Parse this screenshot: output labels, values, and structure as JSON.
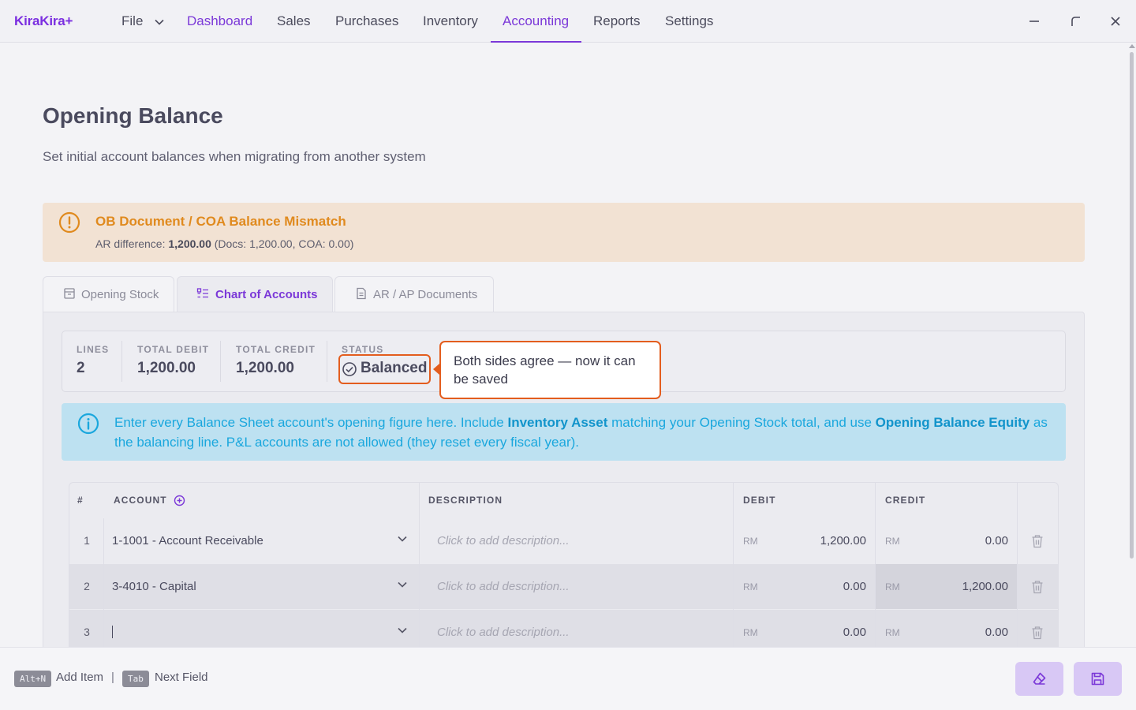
{
  "app": {
    "logo": "KiraKira+"
  },
  "nav": {
    "file": "File",
    "items": [
      "Dashboard",
      "Sales",
      "Purchases",
      "Inventory",
      "Accounting",
      "Reports",
      "Settings"
    ],
    "active": "Accounting"
  },
  "page": {
    "title": "Opening Balance",
    "subtitle": "Set initial account balances when migrating from another system"
  },
  "warning": {
    "title": "OB Document / COA Balance Mismatch",
    "prefix": "AR difference: ",
    "amount": "1,200.00",
    "detail": " (Docs: 1,200.00, COA: 0.00)"
  },
  "tabs": [
    {
      "label": "Opening Stock",
      "icon": "box-icon"
    },
    {
      "label": "Chart of Accounts",
      "icon": "list-icon",
      "active": true
    },
    {
      "label": "AR / AP Documents",
      "icon": "document-icon"
    }
  ],
  "stats": {
    "lines_label": "LINES",
    "lines": "2",
    "debit_label": "TOTAL DEBIT",
    "debit": "1,200.00",
    "credit_label": "TOTAL CREDIT",
    "credit": "1,200.00",
    "status_label": "STATUS",
    "status": "Balanced"
  },
  "tooltip": {
    "text": "Both sides agree — now it can be saved"
  },
  "info": {
    "part1": "Enter every Balance Sheet account's opening figure here. Include ",
    "bold1": "Inventory Asset",
    "part2": " matching your Opening Stock total, and use ",
    "bold2": "Opening Balance Equity",
    "part3": " as the balancing line. P&L accounts are not allowed (they reset every fiscal year)."
  },
  "table": {
    "headers": {
      "num": "#",
      "account": "ACCOUNT",
      "description": "DESCRIPTION",
      "debit": "DEBIT",
      "credit": "CREDIT"
    },
    "currency": "RM",
    "rows": [
      {
        "num": "1",
        "account": "1-1001 - Account Receivable",
        "description": "Click to add description...",
        "debit": "1,200.00",
        "credit": "0.00"
      },
      {
        "num": "2",
        "account": "3-4010 - Capital",
        "description": "Click to add description...",
        "debit": "0.00",
        "credit": "1,200.00"
      },
      {
        "num": "3",
        "account": "",
        "description": "Click to add description...",
        "debit": "0.00",
        "credit": "0.00"
      }
    ]
  },
  "footer": {
    "key1": "Alt+N",
    "hint1": "Add Item",
    "separator": "|",
    "key2": "Tab",
    "hint2": "Next Field"
  },
  "colors": {
    "accent": "#7b38d8",
    "warning": "#e08a1e",
    "highlight": "#e35d1e",
    "info": "#1aa7dd"
  }
}
